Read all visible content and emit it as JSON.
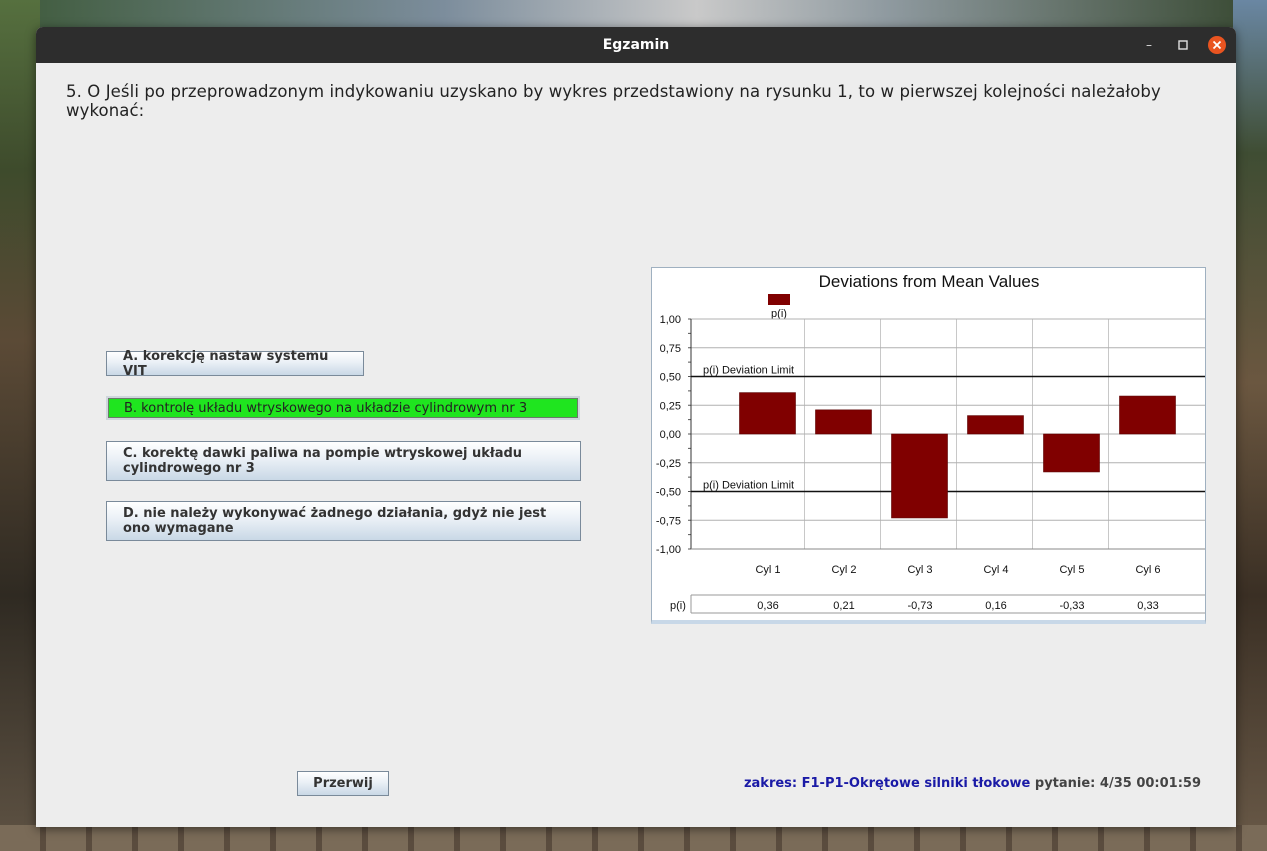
{
  "window": {
    "title": "Egzamin"
  },
  "question": {
    "text": "5. O Jeśli po przeprowadzonym indykowaniu uzyskano by wykres przedstawiony na rysunku 1, to w pierwszej kolejności należałoby wykonać:"
  },
  "answers": [
    {
      "label": "A. korekcję nastaw systemu VIT",
      "selected": false
    },
    {
      "label": "B. kontrolę układu wtryskowego na układzie cylindrowym nr 3",
      "selected": true
    },
    {
      "label": "C. korektę dawki paliwa na pompie wtryskowej układu cylindrowego nr 3",
      "selected": false
    },
    {
      "label": "D. nie należy wykonywać żadnego działania, gdyż nie jest ono wymagane",
      "selected": false
    }
  ],
  "buttons": {
    "stop": "Przerwij"
  },
  "status": {
    "scope": "zakres: F1-P1-Okrętowe silniki tłokowe",
    "progress": "pytanie: 4/35 00:01:59"
  },
  "colors": {
    "bar": "#800000",
    "selected_answer": "#1fe51f",
    "close_button": "#e95420",
    "scope_text": "#1a1aa6"
  },
  "chart_data": {
    "type": "bar",
    "title": "Deviations from Mean Values",
    "categories": [
      "Cyl 1",
      "Cyl 2",
      "Cyl 3",
      "Cyl 4",
      "Cyl 5",
      "Cyl 6"
    ],
    "series": [
      {
        "name": "p(i)",
        "values": [
          0.36,
          0.21,
          -0.73,
          0.16,
          -0.33,
          0.33
        ]
      }
    ],
    "value_labels": [
      "0,36",
      "0,21",
      "-0,73",
      "0,16",
      "-0,33",
      "0,33"
    ],
    "table_row_label": "p(i)",
    "ylim": [
      -1,
      1
    ],
    "y_ticks": [
      1,
      0.75,
      0.5,
      0.25,
      0,
      -0.25,
      -0.5,
      -0.75,
      -1
    ],
    "y_tick_labels": [
      "1,00",
      "0,75",
      "0,50",
      "0,25",
      "0,00",
      "-0,25",
      "-0,50",
      "-0,75",
      "-1,00"
    ],
    "limits": [
      {
        "value": 0.5,
        "label": "p(i) Deviation Limit"
      },
      {
        "value": -0.5,
        "label": "p(i) Deviation Limit"
      }
    ],
    "grid": true,
    "legend": "top-left"
  }
}
